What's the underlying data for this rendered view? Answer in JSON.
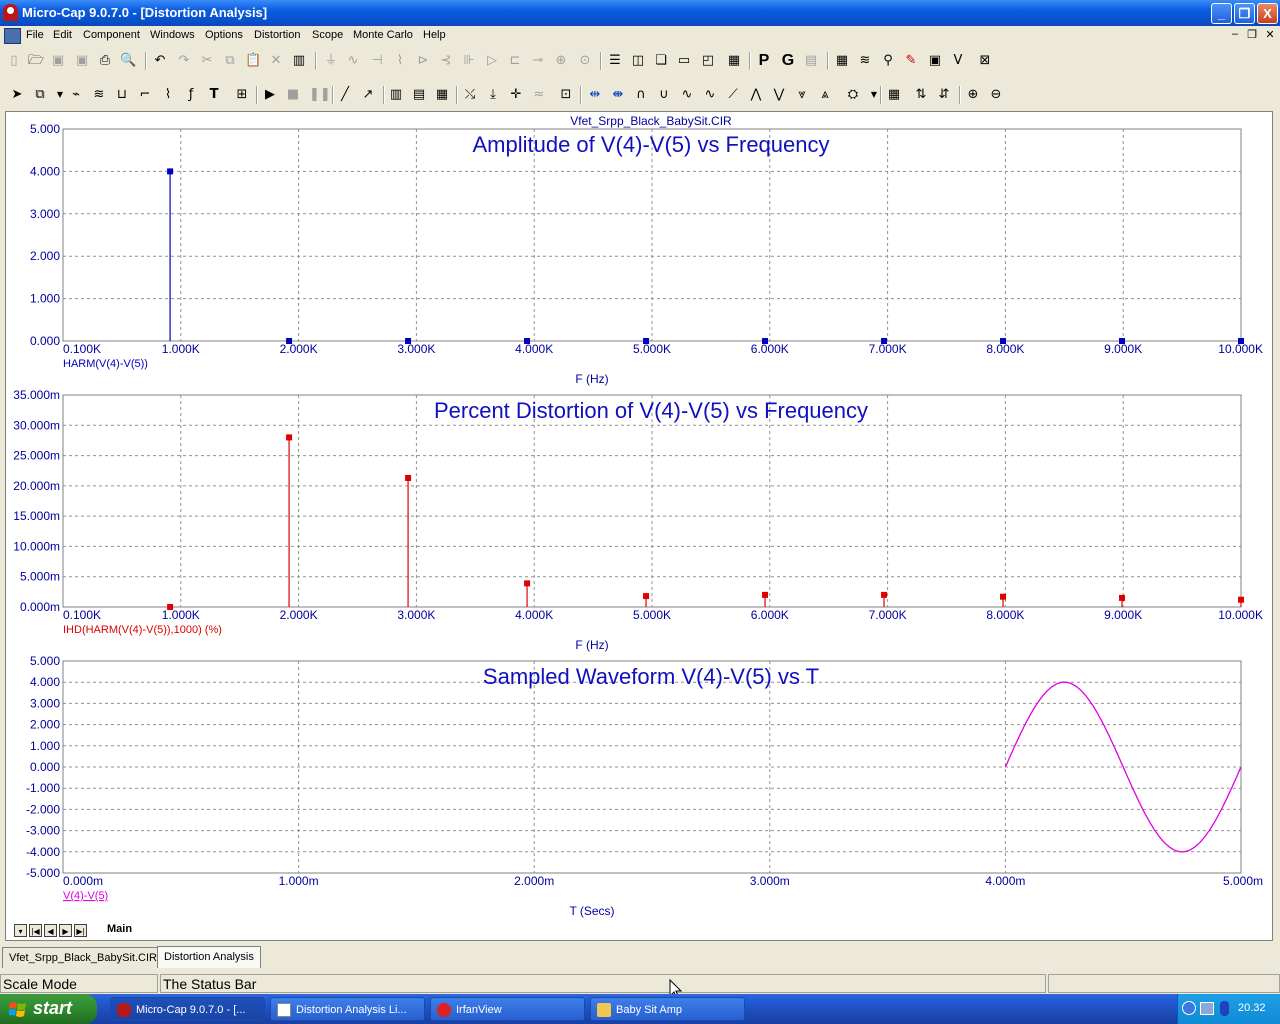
{
  "window": {
    "title": "Micro-Cap 9.0.7.0 - [Distortion Analysis]",
    "min_glyph": "_",
    "max_glyph": "❐",
    "close_glyph": "X"
  },
  "menu": [
    "File",
    "Edit",
    "Component",
    "Windows",
    "Options",
    "Distortion",
    "Scope",
    "Monte Carlo",
    "Help"
  ],
  "circuit_file": "Vfet_Srpp_Black_BabySit.CIR",
  "toolbar_text": {
    "p": "P",
    "g": "G"
  },
  "plots": [
    {
      "title": "Amplitude of V(4)-V(5) vs Frequency",
      "y_ticks": [
        "5.000",
        "4.000",
        "3.000",
        "2.000",
        "1.000",
        "0.000"
      ],
      "x_ticks": [
        "0.100K",
        "1.000K",
        "2.000K",
        "3.000K",
        "4.000K",
        "5.000K",
        "6.000K",
        "7.000K",
        "8.000K",
        "9.000K",
        "10.000K"
      ],
      "trace_label": "HARM(V(4)-V(5))",
      "x_axis_label": "F (Hz)",
      "color": "#0000c0"
    },
    {
      "title": "Percent Distortion of V(4)-V(5) vs Frequency",
      "y_ticks": [
        "35.000m",
        "30.000m",
        "25.000m",
        "20.000m",
        "15.000m",
        "10.000m",
        "5.000m",
        "0.000m"
      ],
      "x_ticks": [
        "0.100K",
        "1.000K",
        "2.000K",
        "3.000K",
        "4.000K",
        "5.000K",
        "6.000K",
        "7.000K",
        "8.000K",
        "9.000K",
        "10.000K"
      ],
      "trace_label": "IHD(HARM(V(4)-V(5)),1000) (%)",
      "x_axis_label": "F (Hz)",
      "color": "#e00000"
    },
    {
      "title": "Sampled Waveform  V(4)-V(5) vs T",
      "y_ticks": [
        "5.000",
        "4.000",
        "3.000",
        "2.000",
        "1.000",
        "0.000",
        "-1.000",
        "-2.000",
        "-3.000",
        "-4.000",
        "-5.000"
      ],
      "x_ticks": [
        "0.000m",
        "1.000m",
        "2.000m",
        "3.000m",
        "4.000m",
        "5.000m"
      ],
      "trace_label": "V(4)-V(5)",
      "x_axis_label": "T (Secs)",
      "color": "#e000e0"
    }
  ],
  "chart_data": [
    {
      "type": "bar",
      "title": "Amplitude of V(4)-V(5) vs Frequency",
      "xlabel": "F (Hz)",
      "ylabel": "",
      "x_unit": "K",
      "xlim": [
        0.1,
        10.0
      ],
      "ylim": [
        0,
        5
      ],
      "series": [
        {
          "name": "HARM(V(4)-V(5))",
          "x": [
            1,
            2,
            3,
            4,
            5,
            6,
            7,
            8,
            9,
            10
          ],
          "values": [
            4.0,
            0.0,
            0.0,
            0.0,
            0.0,
            0.0,
            0.0,
            0.0,
            0.0,
            0.0
          ]
        }
      ],
      "grid": true
    },
    {
      "type": "bar",
      "title": "Percent Distortion of V(4)-V(5) vs Frequency",
      "xlabel": "F (Hz)",
      "ylabel": "",
      "x_unit": "K",
      "xlim": [
        0.1,
        10.0
      ],
      "ylim": [
        0,
        35
      ],
      "y_unit": "m",
      "series": [
        {
          "name": "IHD(HARM(V(4)-V(5)),1000) (%)",
          "x": [
            1,
            2,
            3,
            4,
            5,
            6,
            7,
            8,
            9,
            10
          ],
          "values": [
            0.0,
            28.0,
            21.3,
            3.9,
            1.8,
            2.0,
            2.0,
            1.7,
            1.5,
            1.2
          ]
        }
      ],
      "grid": true
    },
    {
      "type": "line",
      "title": "Sampled Waveform  V(4)-V(5) vs T",
      "xlabel": "T (Secs)",
      "ylabel": "",
      "x_unit": "m",
      "xlim": [
        0,
        5
      ],
      "ylim": [
        -5,
        5
      ],
      "series": [
        {
          "name": "V(4)-V(5)",
          "x": [
            4.0,
            4.125,
            4.25,
            4.375,
            4.5,
            4.625,
            4.75,
            4.875,
            5.0
          ],
          "values": [
            0.0,
            2.83,
            4.0,
            2.83,
            0.0,
            -2.83,
            -4.0,
            -2.83,
            0.0
          ]
        }
      ],
      "grid": true
    }
  ],
  "nav_tab": "Main",
  "doc_tabs": [
    "Vfet_Srpp_Black_BabySit.CIR",
    "Distortion Analysis"
  ],
  "status": {
    "mode": "Scale Mode",
    "text": "The Status Bar"
  },
  "taskbar": {
    "start": "start",
    "tasks": [
      "Micro-Cap 9.0.7.0 - [...",
      "Distortion Analysis Li...",
      "IrfanView",
      "Baby Sit Amp"
    ],
    "clock": "20.32"
  }
}
